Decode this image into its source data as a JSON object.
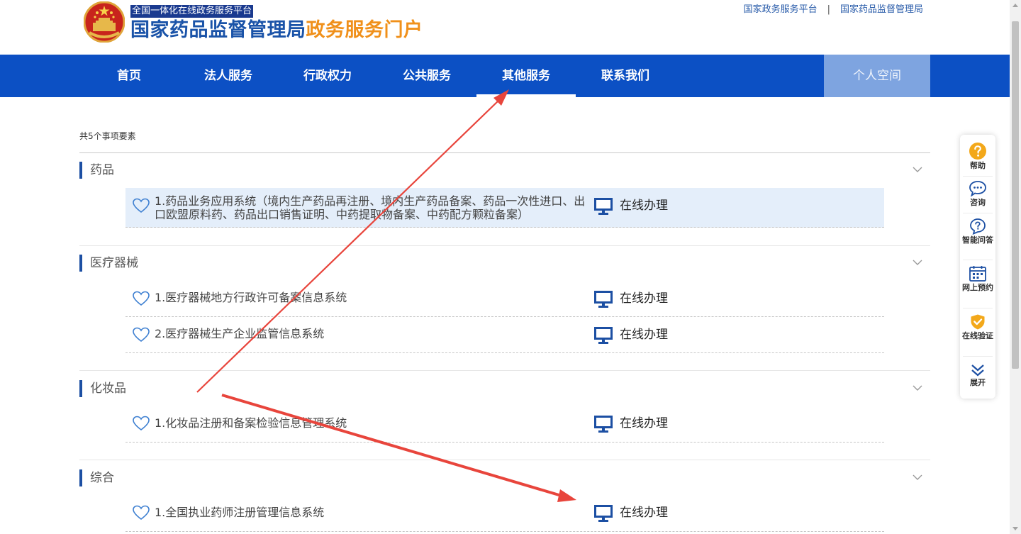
{
  "header": {
    "platform_tag": "全国一体化在线政务服务平台",
    "title_main": "国家药品监督管理局",
    "title_accent": "政务服务门户",
    "links": [
      "国家政务服务平台",
      "国家药品监督管理局"
    ],
    "link_separator": "|"
  },
  "nav": {
    "items": [
      {
        "label": "首页"
      },
      {
        "label": "法人服务"
      },
      {
        "label": "行政权力"
      },
      {
        "label": "公共服务"
      },
      {
        "label": "其他服务",
        "active": true
      },
      {
        "label": "联系我们"
      }
    ],
    "personal_label": "个人空间"
  },
  "main": {
    "count_label": "共5个事项要素",
    "online_label": "在线办理",
    "sections": [
      {
        "name": "药品",
        "items": [
          {
            "title": "1.药品业务应用系统（境内生产药品再注册、境内生产药品备案、药品一次性进口、出口欧盟原料药、药品出口销售证明、中药提取物备案、中药配方颗粒备案）",
            "highlighted": true
          }
        ]
      },
      {
        "name": "医疗器械",
        "items": [
          {
            "title": "1.医疗器械地方行政许可备案信息系统"
          },
          {
            "title": "2.医疗器械生产企业监管信息系统"
          }
        ]
      },
      {
        "name": "化妆品",
        "items": [
          {
            "title": "1.化妆品注册和备案检验信息管理系统"
          }
        ]
      },
      {
        "name": "综合",
        "items": [
          {
            "title": "1.全国执业药师注册管理信息系统"
          }
        ]
      }
    ]
  },
  "side_toolbar": {
    "items": [
      {
        "label": "帮助",
        "icon": "help-icon"
      },
      {
        "label": "咨询",
        "icon": "chat-icon"
      },
      {
        "label": "智能问答",
        "icon": "smart-qa-icon"
      },
      {
        "label": "网上预约",
        "icon": "calendar-icon"
      },
      {
        "label": "在线验证",
        "icon": "shield-check-icon"
      },
      {
        "label": "展开",
        "icon": "double-chevron-down-icon"
      }
    ]
  },
  "colors": {
    "nav_blue": "#0c50c4",
    "personal_bg": "#7ea4e0",
    "title_blue": "#1a53a8",
    "title_orange": "#f0901a",
    "highlight_row": "#e4eefa",
    "annotation_red": "#e8453c"
  }
}
